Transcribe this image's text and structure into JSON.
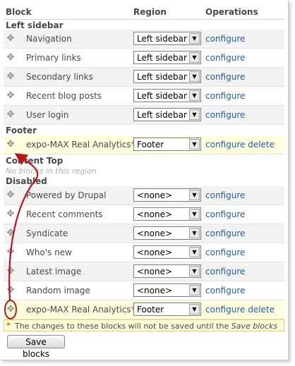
{
  "table": {
    "headers": {
      "block": "Block",
      "region": "Region",
      "operations": "Operations"
    }
  },
  "regions": {
    "left_sidebar": {
      "title": "Left sidebar",
      "rows": [
        {
          "name": "Navigation",
          "region": "Left sidebar",
          "configure": "configure"
        },
        {
          "name": "Primary links",
          "region": "Left sidebar",
          "configure": "configure"
        },
        {
          "name": "Secondary links",
          "region": "Left sidebar",
          "configure": "configure"
        },
        {
          "name": "Recent blog posts",
          "region": "Left sidebar",
          "configure": "configure"
        },
        {
          "name": "User login",
          "region": "Left sidebar",
          "configure": "configure"
        }
      ]
    },
    "footer": {
      "title": "Footer",
      "rows": [
        {
          "name": "expo-MAX Real Analytics",
          "changed_mark": "*",
          "region": "Footer",
          "configure": "configure",
          "delete": "delete"
        }
      ]
    },
    "content_top": {
      "title": "Content Top",
      "empty_message": "No blocks in this region"
    },
    "disabled": {
      "title": "Disabled",
      "rows": [
        {
          "name": "Powered by Drupal",
          "region": "<none>",
          "configure": "configure"
        },
        {
          "name": "Recent comments",
          "region": "<none>",
          "configure": "configure"
        },
        {
          "name": "Syndicate",
          "region": "<none>",
          "configure": "configure"
        },
        {
          "name": "Who's new",
          "region": "<none>",
          "configure": "configure"
        },
        {
          "name": "Latest image",
          "region": "<none>",
          "configure": "configure"
        },
        {
          "name": "Random image",
          "region": "<none>",
          "configure": "configure"
        },
        {
          "name": "expo-MAX Real Analytics",
          "changed_mark": "*",
          "region": "Footer",
          "configure": "configure",
          "delete": "delete"
        }
      ]
    }
  },
  "warning": {
    "mark": "*",
    "text_prefix": "The changes to these blocks will not be saved until the ",
    "text_em": "Save blocks"
  },
  "save_button": "Save blocks",
  "colors": {
    "link": "#1f5ca8",
    "changed_row": "#ffffdd",
    "annotation_arrow": "#b8161c"
  },
  "icons": {
    "drag_handle": "four-way-arrow-icon",
    "select_arrow": "triangle-down-icon"
  }
}
